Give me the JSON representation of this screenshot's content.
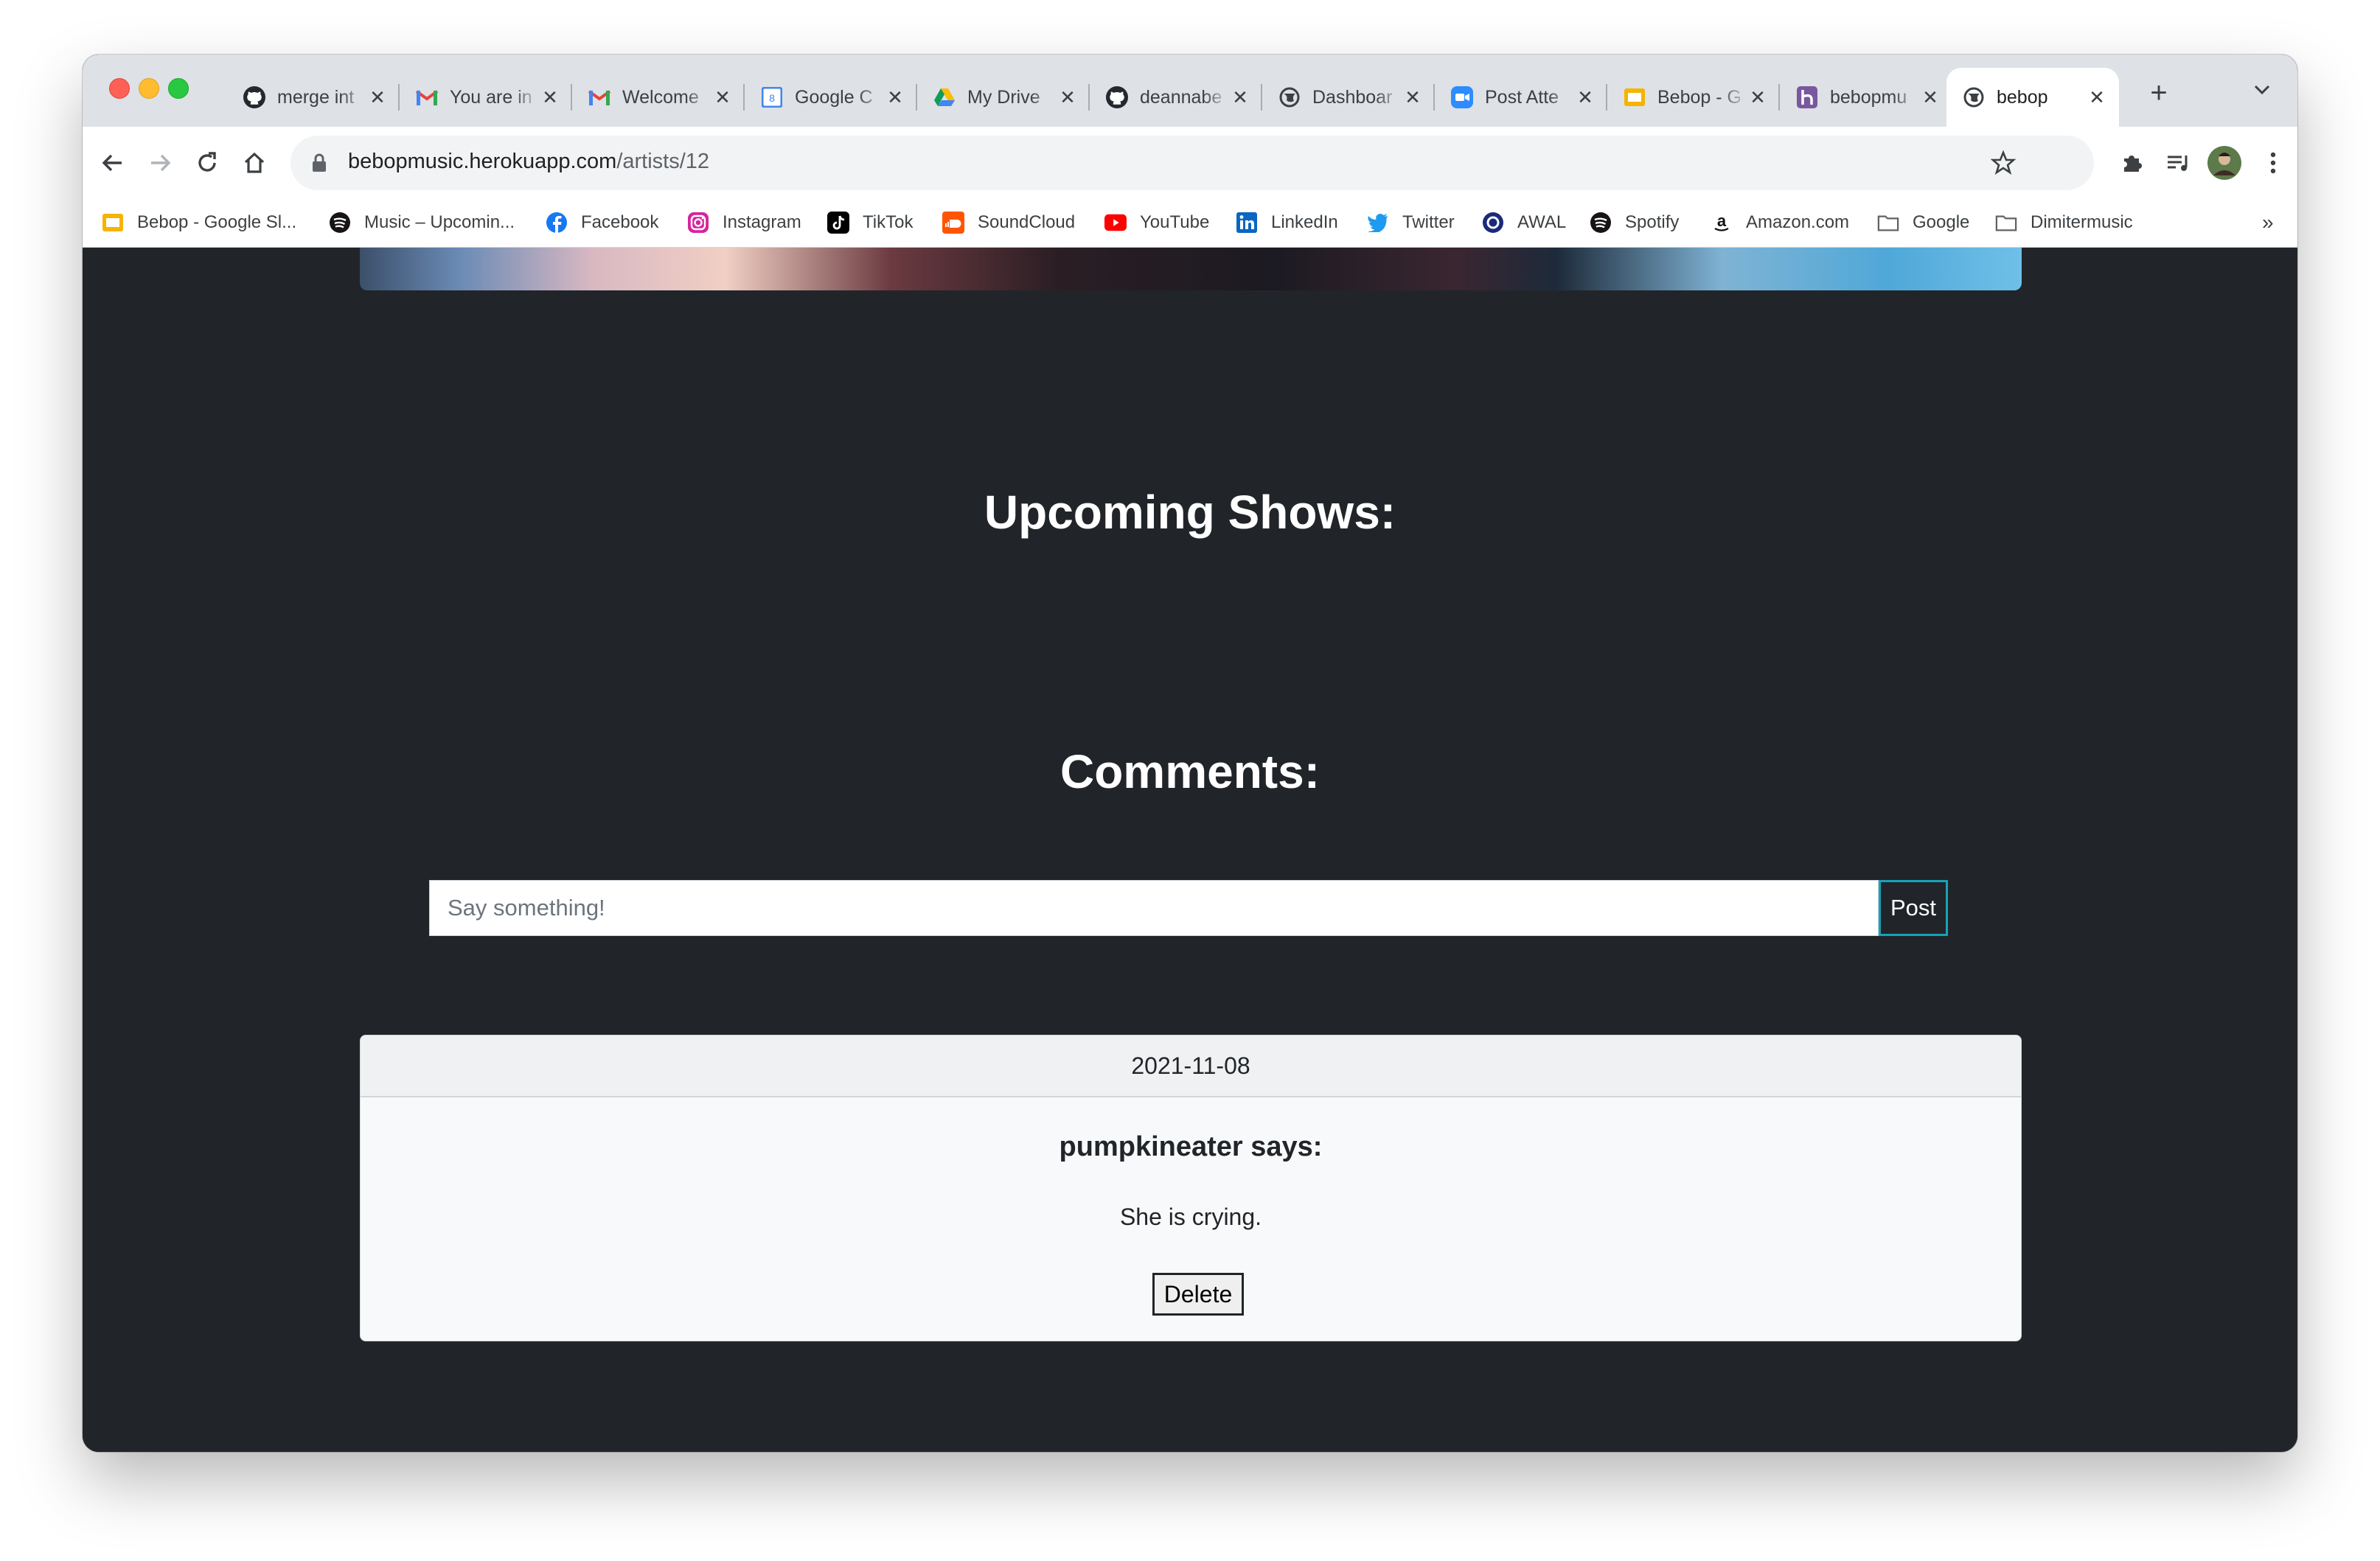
{
  "browser": {
    "tabs": [
      {
        "title": "merge int",
        "icon": "github-icon"
      },
      {
        "title": "You are in",
        "icon": "gmail-icon"
      },
      {
        "title": "Welcome",
        "icon": "gmail-icon"
      },
      {
        "title": "Google C",
        "icon": "google-calendar-icon"
      },
      {
        "title": "My Drive",
        "icon": "google-drive-icon"
      },
      {
        "title": "deannabe",
        "icon": "github-icon"
      },
      {
        "title": "Dashboar",
        "icon": "globe-icon"
      },
      {
        "title": "Post Atte",
        "icon": "zoom-icon"
      },
      {
        "title": "Bebop - G",
        "icon": "google-slides-icon"
      },
      {
        "title": "bebopmu",
        "icon": "heroku-icon"
      },
      {
        "title": "bebop",
        "icon": "globe-icon",
        "active": true
      }
    ],
    "new_tab_symbol": "+",
    "tab_close_symbol": "✕",
    "url_host": "bebopmusic.herokuapp.com",
    "url_path": "/artists/12",
    "bookmarks": [
      {
        "label": "Bebop - Google Sl...",
        "icon": "google-slides-icon"
      },
      {
        "label": "Music – Upcomin...",
        "icon": "spotify-icon"
      },
      {
        "label": "Facebook",
        "icon": "facebook-icon"
      },
      {
        "label": "Instagram",
        "icon": "instagram-icon"
      },
      {
        "label": "TikTok",
        "icon": "tiktok-icon"
      },
      {
        "label": "SoundCloud",
        "icon": "soundcloud-icon"
      },
      {
        "label": "YouTube",
        "icon": "youtube-icon"
      },
      {
        "label": "LinkedIn",
        "icon": "linkedin-icon"
      },
      {
        "label": "Twitter",
        "icon": "twitter-icon"
      },
      {
        "label": "AWAL",
        "icon": "awal-icon"
      },
      {
        "label": "Spotify",
        "icon": "spotify-icon"
      },
      {
        "label": "Amazon.com",
        "icon": "amazon-icon"
      },
      {
        "label": "Google",
        "icon": "folder-icon"
      },
      {
        "label": "Dimitermusic",
        "icon": "folder-icon"
      }
    ],
    "bookmarks_overflow": "»"
  },
  "page": {
    "upcoming_heading": "Upcoming Shows:",
    "comments_heading": "Comments:",
    "comment_placeholder": "Say something!",
    "post_label": "Post",
    "comments": [
      {
        "date": "2021-11-08",
        "author_line": "pumpkineater says:",
        "text": "She is crying.",
        "delete_label": "Delete"
      }
    ]
  },
  "colors": {
    "page_bg": "#212529",
    "tabstrip_bg": "#dee1e6",
    "post_border": "#17a2b8"
  }
}
